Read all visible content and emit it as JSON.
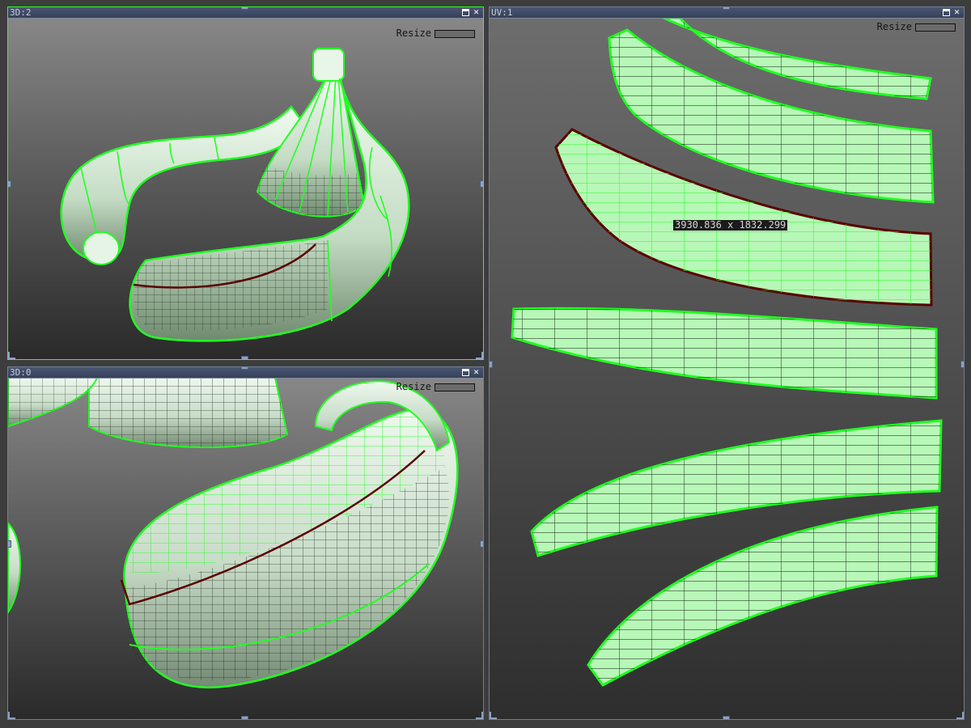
{
  "viewports": [
    {
      "id": "vp-3d2",
      "title": "3D:2",
      "resize_label": "Resize"
    },
    {
      "id": "vp-3d0",
      "title": "3D:0",
      "resize_label": "Resize"
    },
    {
      "id": "vp-uv1",
      "title": "UV:1",
      "resize_label": "Resize"
    }
  ],
  "uv_editor": {
    "selection_size": "3930.836 x 1832.299"
  },
  "window_buttons": {
    "close": "✕"
  },
  "colors": {
    "seam_green": "#22ff22",
    "selected_seam": "#5a0000",
    "surface": "#cfe8cf",
    "uv_fill": "#b7f7b7",
    "active_border": "#2aff2a"
  },
  "icons": [
    "maximize-icon",
    "close-icon",
    "resize-handle-icon"
  ]
}
